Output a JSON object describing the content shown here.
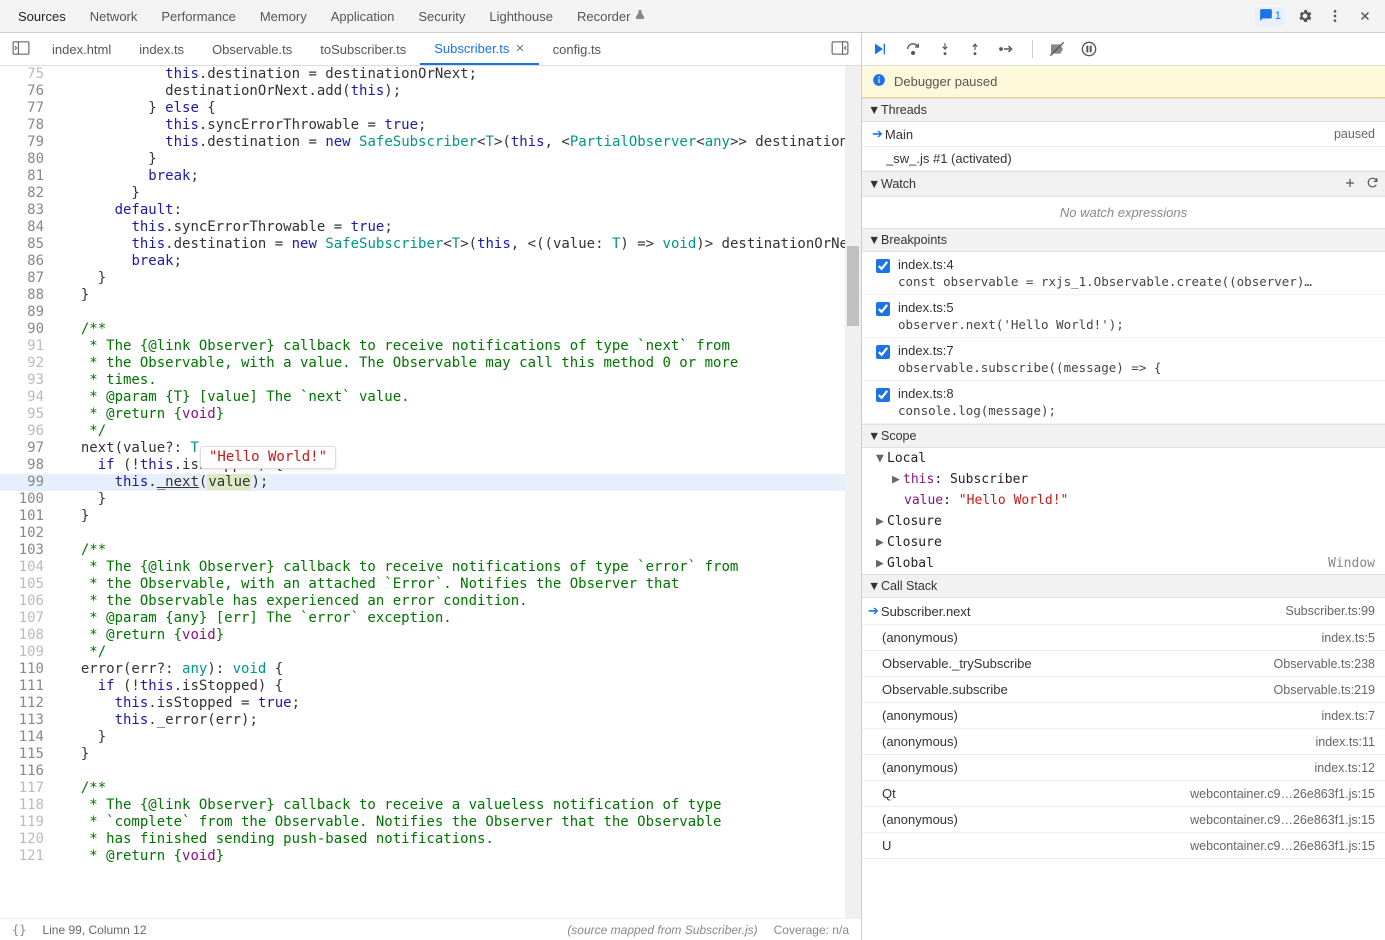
{
  "topnav": {
    "tabs": [
      "Sources",
      "Network",
      "Performance",
      "Memory",
      "Application",
      "Security",
      "Lighthouse"
    ],
    "recorder_label": "Recorder",
    "msg_count": "1"
  },
  "filetabs": {
    "files": [
      "index.html",
      "index.ts",
      "Observable.ts",
      "toSubscriber.ts",
      "Subscriber.ts",
      "config.ts"
    ],
    "active_index": 4
  },
  "editor": {
    "tooltip": "\"Hello World!\"",
    "breadcrumbs_icon": "{}",
    "status_line": "Line 99, Column 12",
    "source_map": "(source mapped from Subscriber.js)",
    "coverage": "Coverage: n/a",
    "lines": [
      {
        "n": 75,
        "fade": true,
        "html": "            <span class='k-blue'>this</span>.destination = destinationOrNext;"
      },
      {
        "n": 76,
        "html": "            destinationOrNext.add(<span class='k-blue'>this</span>);"
      },
      {
        "n": 77,
        "html": "          } <span class='k-blue'>else</span> {"
      },
      {
        "n": 78,
        "html": "            <span class='k-blue'>this</span>.syncErrorThrowable = <span class='k-blue'>true</span>;"
      },
      {
        "n": 79,
        "html": "            <span class='k-blue'>this</span>.destination = <span class='k-blue'>new</span> <span class='k-teal'>SafeSubscriber</span>&lt;<span class='k-teal'>T</span>&gt;(<span class='k-blue'>this</span>, &lt;<span class='k-teal'>PartialObserver</span>&lt;<span class='k-teal'>any</span>&gt;&gt; destination"
      },
      {
        "n": 80,
        "html": "          }"
      },
      {
        "n": 81,
        "html": "          <span class='k-blue'>break</span>;"
      },
      {
        "n": 82,
        "html": "        }"
      },
      {
        "n": 83,
        "html": "      <span class='k-blue'>default</span>:"
      },
      {
        "n": 84,
        "html": "        <span class='k-blue'>this</span>.syncErrorThrowable = <span class='k-blue'>true</span>;"
      },
      {
        "n": 85,
        "html": "        <span class='k-blue'>this</span>.destination = <span class='k-blue'>new</span> <span class='k-teal'>SafeSubscriber</span>&lt;<span class='k-teal'>T</span>&gt;(<span class='k-blue'>this</span>, &lt;((value: <span class='k-teal'>T</span>) =&gt; <span class='k-teal'>void</span>)&gt; destinationOrNe"
      },
      {
        "n": 86,
        "html": "        <span class='k-blue'>break</span>;"
      },
      {
        "n": 87,
        "html": "    }"
      },
      {
        "n": 88,
        "html": "  }"
      },
      {
        "n": 89,
        "html": ""
      },
      {
        "n": 90,
        "html": "  <span class='k-green'>/**</span>"
      },
      {
        "n": 91,
        "fade": true,
        "html": "<span class='k-green'>   * The {@link Observer} callback to receive notifications of type `next` from</span>"
      },
      {
        "n": 92,
        "fade": true,
        "html": "<span class='k-green'>   * the Observable, with a value. The Observable may call this method 0 or more</span>"
      },
      {
        "n": 93,
        "fade": true,
        "html": "<span class='k-green'>   * times.</span>"
      },
      {
        "n": 94,
        "fade": true,
        "html": "<span class='k-green'>   * @param {T} [value] The `next` value.</span>"
      },
      {
        "n": 95,
        "fade": true,
        "html": "<span class='k-green'>   * @return {<span class='k-purple'>void</span>}</span>"
      },
      {
        "n": 96,
        "fade": true,
        "html": "<span class='k-green'>   */</span>"
      },
      {
        "n": 97,
        "html": "  next(value?: <span class='k-teal'>T</span>"
      },
      {
        "n": 98,
        "html": "    <span class='k-blue'>if</span> (!<span class='k-blue'>this</span>.isStopped) {"
      },
      {
        "n": 99,
        "hl": true,
        "html": "      <span class='k-blue'>this</span>.<span style='text-decoration:underline'>_next</span>(<span class='value-hl'>value</span>);"
      },
      {
        "n": 100,
        "html": "    }"
      },
      {
        "n": 101,
        "html": "  }"
      },
      {
        "n": 102,
        "html": ""
      },
      {
        "n": 103,
        "html": "  <span class='k-green'>/**</span>"
      },
      {
        "n": 104,
        "fade": true,
        "html": "<span class='k-green'>   * The {@link Observer} callback to receive notifications of type `error` from</span>"
      },
      {
        "n": 105,
        "fade": true,
        "html": "<span class='k-green'>   * the Observable, with an attached `Error`. Notifies the Observer that</span>"
      },
      {
        "n": 106,
        "fade": true,
        "html": "<span class='k-green'>   * the Observable has experienced an error condition.</span>"
      },
      {
        "n": 107,
        "fade": true,
        "html": "<span class='k-green'>   * @param {any} [err] The `error` exception.</span>"
      },
      {
        "n": 108,
        "fade": true,
        "html": "<span class='k-green'>   * @return {<span class='k-purple'>void</span>}</span>"
      },
      {
        "n": 109,
        "fade": true,
        "html": "<span class='k-green'>   */</span>"
      },
      {
        "n": 110,
        "html": "  error(err?: <span class='k-teal'>any</span>): <span class='k-teal'>void</span> {"
      },
      {
        "n": 111,
        "html": "    <span class='k-blue'>if</span> (!<span class='k-blue'>this</span>.isStopped) {"
      },
      {
        "n": 112,
        "html": "      <span class='k-blue'>this</span>.isStopped = <span class='k-blue'>true</span>;"
      },
      {
        "n": 113,
        "html": "      <span class='k-blue'>this</span>._error(err);"
      },
      {
        "n": 114,
        "html": "    }"
      },
      {
        "n": 115,
        "html": "  }"
      },
      {
        "n": 116,
        "html": ""
      },
      {
        "n": 117,
        "fade": true,
        "html": "  <span class='k-green'>/**</span>"
      },
      {
        "n": 118,
        "fade": true,
        "html": "<span class='k-green'>   * The {@link Observer} callback to receive a valueless notification of type</span>"
      },
      {
        "n": 119,
        "fade": true,
        "html": "<span class='k-green'>   * `complete` from the Observable. Notifies the Observer that the Observable</span>"
      },
      {
        "n": 120,
        "fade": true,
        "html": "<span class='k-green'>   * has finished sending push-based notifications.</span>"
      },
      {
        "n": 121,
        "fade": true,
        "html": "<span class='k-green'>   * @return {<span class='k-purple'>void</span>}</span>"
      }
    ]
  },
  "debugpane": {
    "banner": "Debugger paused",
    "threads_hdr": "Threads",
    "threads": [
      {
        "name": "Main",
        "state": "paused",
        "arrow": true
      },
      {
        "name": "_sw_.js #1 (activated)",
        "state": ""
      }
    ],
    "watch_hdr": "Watch",
    "watch_empty": "No watch expressions",
    "breakpoints_hdr": "Breakpoints",
    "breakpoints": [
      {
        "loc": "index.ts:4",
        "code": "const observable = rxjs_1.Observable.create((observer)…"
      },
      {
        "loc": "index.ts:5",
        "code": "observer.next('Hello World!');"
      },
      {
        "loc": "index.ts:7",
        "code": "observable.subscribe((message) => {"
      },
      {
        "loc": "index.ts:8",
        "code": "console.log(message);"
      }
    ],
    "scope_hdr": "Scope",
    "scope": {
      "local_label": "Local",
      "this_label": "this",
      "this_val": "Subscriber",
      "value_label": "value",
      "value_val": "\"Hello World!\"",
      "closure1": "Closure",
      "closure2": "Closure",
      "global_label": "Global",
      "global_val": "Window"
    },
    "callstack_hdr": "Call Stack",
    "callstack": [
      {
        "fn": "Subscriber.next",
        "loc": "Subscriber.ts:99",
        "cur": true
      },
      {
        "fn": "(anonymous)",
        "loc": "index.ts:5"
      },
      {
        "fn": "Observable._trySubscribe",
        "loc": "Observable.ts:238"
      },
      {
        "fn": "Observable.subscribe",
        "loc": "Observable.ts:219"
      },
      {
        "fn": "(anonymous)",
        "loc": "index.ts:7"
      },
      {
        "fn": "(anonymous)",
        "loc": "index.ts:11"
      },
      {
        "fn": "(anonymous)",
        "loc": "index.ts:12"
      },
      {
        "fn": "Qt",
        "loc": "webcontainer.c9…26e863f1.js:15"
      },
      {
        "fn": "(anonymous)",
        "loc": "webcontainer.c9…26e863f1.js:15"
      },
      {
        "fn": "U",
        "loc": "webcontainer.c9…26e863f1.js:15"
      }
    ]
  }
}
